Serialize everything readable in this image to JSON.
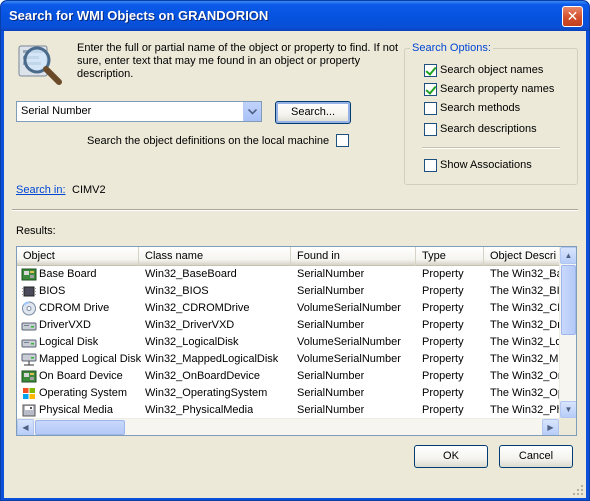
{
  "window": {
    "title": "Search for WMI Objects on GRANDORION",
    "close_label": "✕"
  },
  "intro": {
    "text": "Enter the full or partial name of the object or property to find. If not sure, enter text that may me found in an object or property description."
  },
  "search": {
    "value": "Serial Number",
    "button_label": "Search...",
    "local_label": "Search the object definitions on the local machine",
    "local_checked": false
  },
  "options": {
    "title": "Search Options:",
    "items": [
      {
        "label": "Search object names",
        "checked": true
      },
      {
        "label": "Search property names",
        "checked": true
      },
      {
        "label": "Search methods",
        "checked": false
      },
      {
        "label": "Search descriptions",
        "checked": false
      }
    ],
    "associations": {
      "label": "Show Associations",
      "checked": false
    }
  },
  "search_in": {
    "label": "Search in:",
    "value": "CIMV2"
  },
  "results": {
    "label": "Results:",
    "columns": [
      "Object",
      "Class name",
      "Found in",
      "Type",
      "Object Descri"
    ],
    "rows": [
      {
        "icon": "board-icon",
        "object": "Base Board",
        "class": "Win32_BaseBoard",
        "found": "SerialNumber",
        "type": "Property",
        "desc": "The Win32_Ba"
      },
      {
        "icon": "chip-icon",
        "object": "BIOS",
        "class": "Win32_BIOS",
        "found": "SerialNumber",
        "type": "Property",
        "desc": "The Win32_BI"
      },
      {
        "icon": "cdrom-icon",
        "object": "CDROM Drive",
        "class": "Win32_CDROMDrive",
        "found": "VolumeSerialNumber",
        "type": "Property",
        "desc": "The Win32_CD"
      },
      {
        "icon": "drive-icon",
        "object": "DriverVXD",
        "class": "Win32_DriverVXD",
        "found": "SerialNumber",
        "type": "Property",
        "desc": "The Win32_Dr"
      },
      {
        "icon": "drive-icon",
        "object": "Logical Disk",
        "class": "Win32_LogicalDisk",
        "found": "VolumeSerialNumber",
        "type": "Property",
        "desc": "The Win32_Lo"
      },
      {
        "icon": "network-drive-icon",
        "object": "Mapped Logical Disk",
        "class": "Win32_MappedLogicalDisk",
        "found": "VolumeSerialNumber",
        "type": "Property",
        "desc": "The Win32_Ma"
      },
      {
        "icon": "board-icon",
        "object": "On Board Device",
        "class": "Win32_OnBoardDevice",
        "found": "SerialNumber",
        "type": "Property",
        "desc": "The Win32_On"
      },
      {
        "icon": "windows-icon",
        "object": "Operating System",
        "class": "Win32_OperatingSystem",
        "found": "SerialNumber",
        "type": "Property",
        "desc": "The Win32_Op"
      },
      {
        "icon": "media-icon",
        "object": "Physical Media",
        "class": "Win32_PhysicalMedia",
        "found": "SerialNumber",
        "type": "Property",
        "desc": "The Win32_Ph"
      }
    ]
  },
  "buttons": {
    "ok": "OK",
    "cancel": "Cancel"
  }
}
